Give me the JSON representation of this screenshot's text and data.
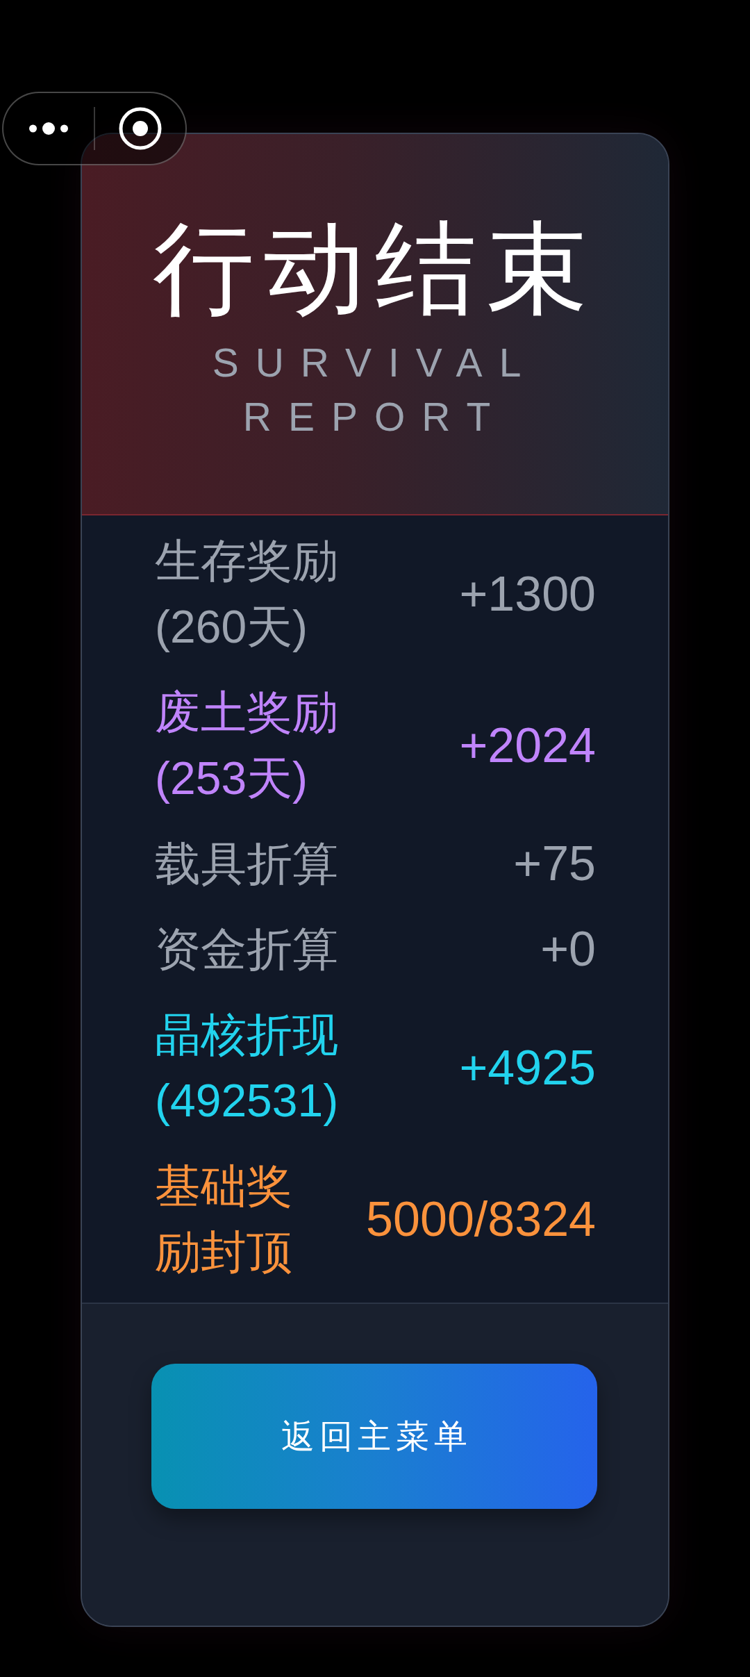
{
  "header": {
    "title": "行动结束",
    "subtitle": "SURVIVAL REPORT"
  },
  "rewards": [
    {
      "label": "生存奖励 (260天)",
      "value": "+1300",
      "color": "#9ca3af"
    },
    {
      "label": "废土奖励 (253天)",
      "value": "+2024",
      "color": "#c084fc"
    },
    {
      "label": "载具折算",
      "value": "+75",
      "color": "#9ca3af"
    },
    {
      "label": "资金折算",
      "value": "+0",
      "color": "#9ca3af"
    },
    {
      "label": "晶核折现 (492531)",
      "value": "+4925",
      "color": "#22d3ee"
    },
    {
      "label": "基础奖励封顶",
      "value": "5000/8324",
      "color": "#fb923c"
    }
  ],
  "button": {
    "label": "返回主菜单"
  }
}
